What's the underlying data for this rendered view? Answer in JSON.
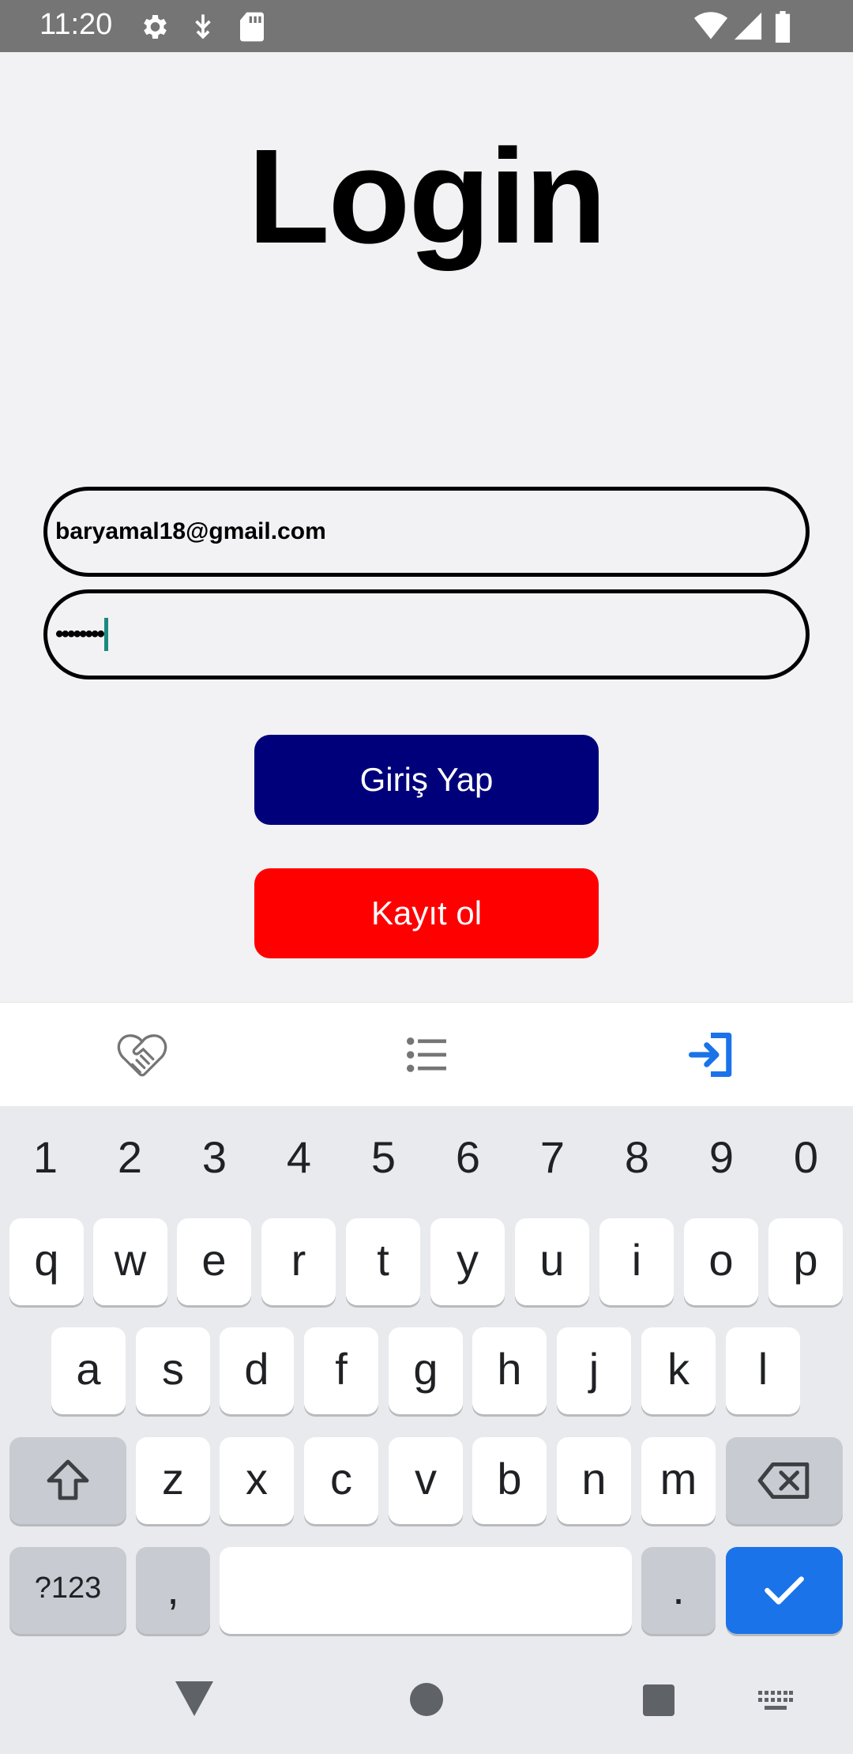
{
  "status_bar": {
    "time": "11:20",
    "icons": [
      "gear-icon",
      "usb-debug-icon",
      "sd-card-icon",
      "wifi-icon",
      "signal-icon",
      "battery-icon"
    ]
  },
  "login": {
    "title": "Login",
    "email_value": "baryamal18@gmail.com",
    "password_value": "••••••••",
    "login_button": "Giriş Yap",
    "register_button": "Kayıt ol"
  },
  "colors": {
    "login_button_bg": "#00007b",
    "register_button_bg": "#ff0000",
    "tab_active": "#1a73e8",
    "tab_inactive": "#757575"
  },
  "tabs": [
    {
      "icon": "handshake-icon",
      "active": false
    },
    {
      "icon": "list-icon",
      "active": false
    },
    {
      "icon": "login-icon",
      "active": true
    }
  ],
  "keyboard": {
    "numbers": [
      "1",
      "2",
      "3",
      "4",
      "5",
      "6",
      "7",
      "8",
      "9",
      "0"
    ],
    "row1": [
      "q",
      "w",
      "e",
      "r",
      "t",
      "y",
      "u",
      "i",
      "o",
      "p"
    ],
    "row2": [
      "a",
      "s",
      "d",
      "f",
      "g",
      "h",
      "j",
      "k",
      "l"
    ],
    "row3": [
      "z",
      "x",
      "c",
      "v",
      "b",
      "n",
      "m"
    ],
    "symbols_key": "?123",
    "comma_key": ",",
    "period_key": "."
  }
}
